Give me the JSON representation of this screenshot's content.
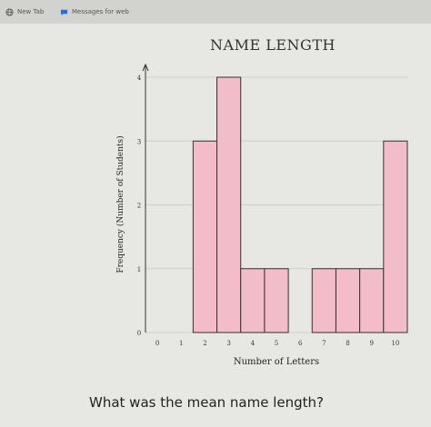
{
  "browser": {
    "tabs": [
      {
        "label": "New Tab",
        "icon": "globe-icon"
      },
      {
        "label": "Messages for web",
        "icon": "messages-icon"
      }
    ]
  },
  "main": {
    "question": "What was the mean name length?"
  },
  "chart_data": {
    "type": "bar",
    "title": "NAME LENGTH",
    "xlabel": "Number of Letters",
    "ylabel": "Frequency (Number of Students)",
    "categories": [
      "0",
      "1",
      "2",
      "3",
      "4",
      "5",
      "6",
      "7",
      "8",
      "9",
      "10"
    ],
    "values": [
      0,
      0,
      3,
      4,
      1,
      1,
      0,
      1,
      1,
      1,
      3
    ],
    "ylim": [
      0,
      4
    ],
    "yticks": [
      "0",
      "1",
      "2",
      "3",
      "4"
    ],
    "grid": true,
    "bar_color": "#f2bdc9",
    "bar_edge": "#333333"
  }
}
